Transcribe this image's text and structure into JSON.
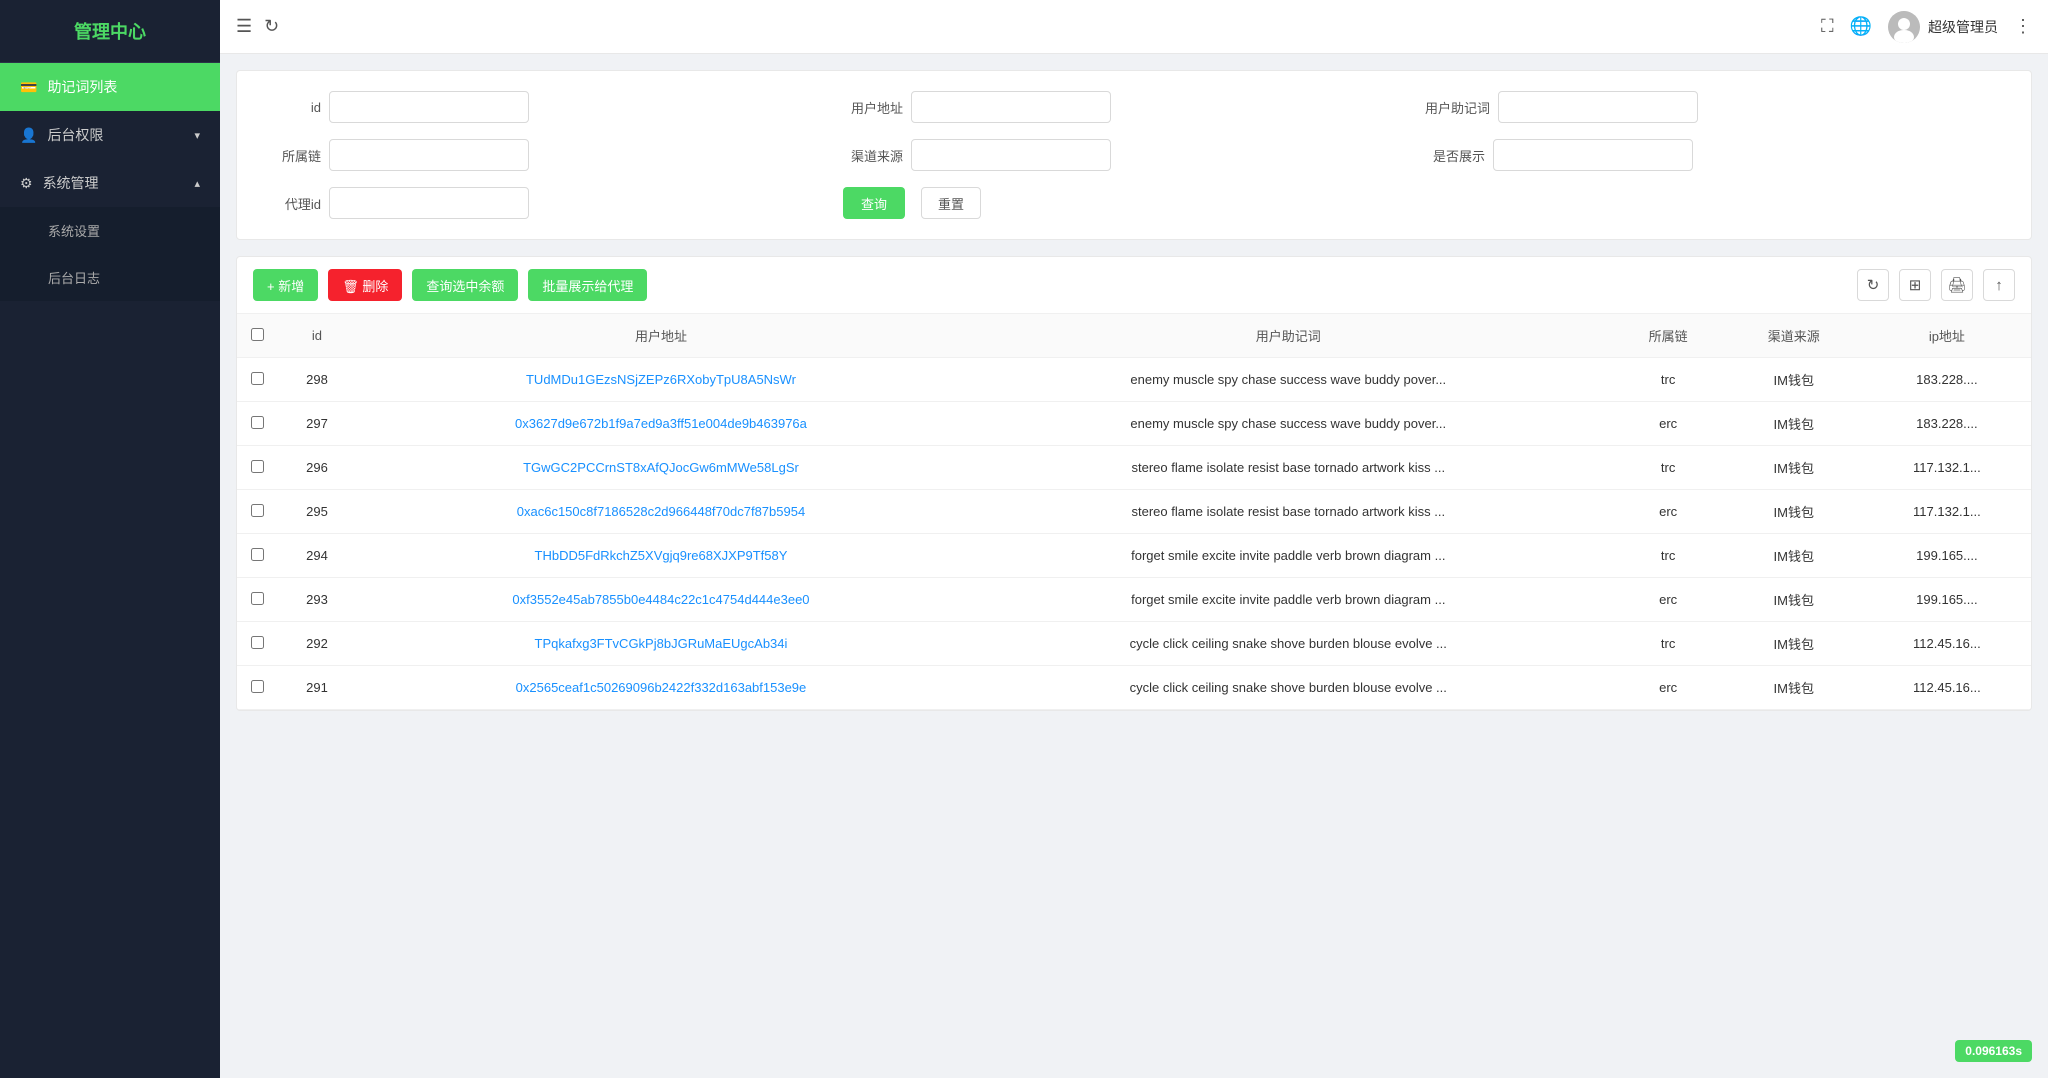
{
  "sidebar": {
    "title": "管理中心",
    "items": [
      {
        "id": "mnemonic-list",
        "label": "助记词列表",
        "icon": "💳",
        "active": true,
        "hasChildren": false
      },
      {
        "id": "backend-perms",
        "label": "后台权限",
        "icon": "👤",
        "active": false,
        "hasChildren": true,
        "expanded": false
      },
      {
        "id": "system-mgmt",
        "label": "系统管理",
        "icon": "⚙",
        "active": false,
        "hasChildren": true,
        "expanded": true
      }
    ],
    "subItems": [
      {
        "id": "system-settings",
        "label": "系统设置",
        "parent": "system-mgmt"
      },
      {
        "id": "backend-log",
        "label": "后台日志",
        "parent": "system-mgmt"
      }
    ]
  },
  "header": {
    "username": "超级管理员",
    "more_icon": "⋮"
  },
  "filter": {
    "fields": [
      {
        "id": "id-field",
        "label": "id",
        "placeholder": ""
      },
      {
        "id": "user-address-field",
        "label": "用户地址",
        "placeholder": ""
      },
      {
        "id": "user-mnemonic-field",
        "label": "用户助记词",
        "placeholder": ""
      },
      {
        "id": "chain-field",
        "label": "所属链",
        "placeholder": ""
      },
      {
        "id": "channel-field",
        "label": "渠道来源",
        "placeholder": ""
      },
      {
        "id": "show-field",
        "label": "是否展示",
        "placeholder": ""
      },
      {
        "id": "agent-id-field",
        "label": "代理id",
        "placeholder": ""
      }
    ],
    "search_label": "查询",
    "reset_label": "重置"
  },
  "toolbar": {
    "add_label": "+ 新增",
    "del_label": "🗑 删除",
    "query_balance_label": "查询选中余额",
    "batch_show_label": "批量展示给代理"
  },
  "table": {
    "columns": [
      "id",
      "用户地址",
      "用户助记词",
      "所属链",
      "渠道来源",
      "ip地址"
    ],
    "rows": [
      {
        "id": "298",
        "address": "TUdMDu1GEzsNSjZEPz6RXobyTpU8A5NsWr",
        "address_type": "trc",
        "mnemonic": "enemy muscle spy chase success wave buddy pover...",
        "chain": "trc",
        "channel": "IM钱包",
        "ip": "183.228...."
      },
      {
        "id": "297",
        "address": "0x3627d9e672b1f9a7ed9a3ff51e004de9b463976a",
        "address_type": "erc",
        "mnemonic": "enemy muscle spy chase success wave buddy pover...",
        "chain": "erc",
        "channel": "IM钱包",
        "ip": "183.228...."
      },
      {
        "id": "296",
        "address": "TGwGC2PCCrnST8xAfQJocGw6mMWe58LgSr",
        "address_type": "trc",
        "mnemonic": "stereo flame isolate resist base tornado artwork kiss ...",
        "chain": "trc",
        "channel": "IM钱包",
        "ip": "117.132.1..."
      },
      {
        "id": "295",
        "address": "0xac6c150c8f7186528c2d966448f70dc7f87b5954",
        "address_type": "erc",
        "mnemonic": "stereo flame isolate resist base tornado artwork kiss ...",
        "chain": "erc",
        "channel": "IM钱包",
        "ip": "117.132.1..."
      },
      {
        "id": "294",
        "address": "THbDD5FdRkchZ5XVgjq9re68XJXP9Tf58Y",
        "address_type": "trc",
        "mnemonic": "forget smile excite invite paddle verb brown diagram ...",
        "chain": "trc",
        "channel": "IM钱包",
        "ip": "199.165...."
      },
      {
        "id": "293",
        "address": "0xf3552e45ab7855b0e4484c22c1c4754d444e3ee0",
        "address_type": "erc",
        "mnemonic": "forget smile excite invite paddle verb brown diagram ...",
        "chain": "erc",
        "channel": "IM钱包",
        "ip": "199.165...."
      },
      {
        "id": "292",
        "address": "TPqkafxg3FTvCGkPj8bJGRuMaEUgcAb34i",
        "address_type": "trc",
        "mnemonic": "cycle click ceiling snake shove burden blouse evolve ...",
        "chain": "trc",
        "channel": "IM钱包",
        "ip": "112.45.16..."
      },
      {
        "id": "291",
        "address": "0x2565ceaf1c50269096b2422f332d163abf153e9e",
        "address_type": "erc",
        "mnemonic": "cycle click ceiling snake shove burden blouse evolve ...",
        "chain": "erc",
        "channel": "IM钱包",
        "ip": "112.45.16..."
      }
    ]
  },
  "badge": {
    "value": "0.096163s"
  }
}
